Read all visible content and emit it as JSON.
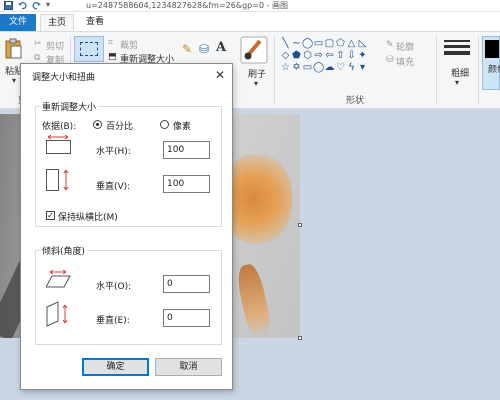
{
  "window": {
    "title": "u=2487588604,1234827628&fm=26&gp=0 - 画图"
  },
  "ribbon": {
    "tabs": {
      "file": "文件",
      "home": "主页",
      "view": "查看"
    },
    "clipboard": {
      "paste": "粘贴",
      "cut": "剪切",
      "copy": "复制",
      "group_label": "剪"
    },
    "image": {
      "crop": "裁剪",
      "resize": "重新调整大小"
    },
    "brushes": {
      "label": "刷子"
    },
    "shapes": {
      "outline": "轮廓",
      "fill": "填充",
      "group_label": "形状"
    },
    "size": {
      "label": "粗细"
    },
    "color": {
      "label": "颜色"
    },
    "colors_short": "颜\n色"
  },
  "dialog": {
    "title": "调整大小和扭曲",
    "close_glyph": "✕",
    "resize": {
      "legend": "重新调整大小",
      "by_label": "依据(B):",
      "percent_label": "百分比",
      "pixels_label": "像素",
      "horizontal_label": "水平(H):",
      "horizontal_value": "100",
      "vertical_label": "垂直(V):",
      "vertical_value": "100",
      "keep_ratio_label": "保持纵横比(M)",
      "keep_ratio_checked": true,
      "selected_unit": "percent"
    },
    "skew": {
      "legend": "倾斜(角度)",
      "horizontal_label": "水平(O):",
      "horizontal_value": "0",
      "vertical_label": "垂直(E):",
      "vertical_value": "0"
    },
    "ok_label": "确定",
    "cancel_label": "取消"
  },
  "colors": {
    "accent": "#1979ca",
    "ribbon_bg": "#f5f6f7",
    "canvas_bg": "#cbd5e3"
  }
}
